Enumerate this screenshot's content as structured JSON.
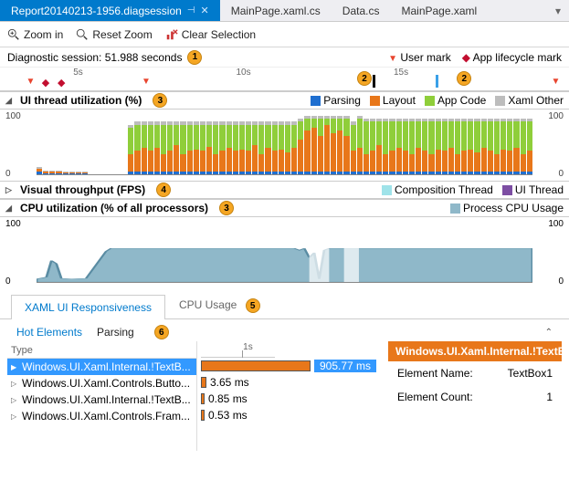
{
  "tabs": {
    "active": "Report20140213-1956.diagsession",
    "others": [
      "MainPage.xaml.cs",
      "Data.cs",
      "MainPage.xaml"
    ]
  },
  "toolbar": {
    "zoom_in": "Zoom in",
    "reset_zoom": "Reset Zoom",
    "clear_sel": "Clear Selection"
  },
  "session": {
    "label": "Diagnostic session: 51.988 seconds",
    "badge": "1"
  },
  "marks": {
    "user": "User mark",
    "lifecycle": "App lifecycle mark"
  },
  "ruler": {
    "ticks": [
      "5s",
      "10s",
      "15s"
    ],
    "badges": [
      "2",
      "2"
    ]
  },
  "ui_thread": {
    "title": "UI thread utilization (%)",
    "badge": "3",
    "legend": {
      "parsing": "Parsing",
      "layout": "Layout",
      "appcode": "App Code",
      "other": "Xaml Other"
    },
    "ymax": "100",
    "ymin": "0"
  },
  "visual": {
    "title": "Visual throughput (FPS)",
    "badge": "4",
    "legend": {
      "comp": "Composition Thread",
      "ui": "UI Thread"
    }
  },
  "cpu": {
    "title": "CPU utilization (% of all processors)",
    "badge": "3",
    "legend": {
      "proc": "Process CPU Usage"
    },
    "ymax": "100",
    "ymin": "0"
  },
  "bottom_tabs": {
    "resp": "XAML UI Responsiveness",
    "cpu": "CPU Usage",
    "badge": "5"
  },
  "sub_tabs": {
    "hot": "Hot Elements",
    "parsing": "Parsing",
    "badge": "6"
  },
  "tree": {
    "header": "Type",
    "rows": [
      "Windows.UI.Xaml.Internal.!TextB...",
      "Windows.UI.Xaml.Controls.Butto...",
      "Windows.UI.Xaml.Internal.!TextB...",
      "Windows.UI.Xaml.Controls.Fram..."
    ]
  },
  "bar_rows": {
    "tick": "1s",
    "r0": "905.77 ms",
    "r1": "3.65 ms",
    "r2": "0.85 ms",
    "r3": "0.53 ms"
  },
  "panel": {
    "title": "Windows.UI.Xaml.Internal.!TextB",
    "name_lbl": "Element Name:",
    "name_val": "TextBox1",
    "count_lbl": "Element Count:",
    "count_val": "1"
  },
  "colors": {
    "parsing": "#1f6fd0",
    "layout": "#e8771a",
    "appcode": "#8fce3a",
    "other": "#bdbdbd",
    "comp": "#9fe3e9",
    "uithread": "#7d4ea3",
    "cpu": "#8fb8c9"
  },
  "chart_data": {
    "type": "bar",
    "stacked": true,
    "categories_seconds": [
      0,
      52
    ],
    "ylim": [
      0,
      100
    ],
    "title": "UI thread utilization (%)",
    "series_names": [
      "Parsing",
      "Layout",
      "App Code",
      "Xaml Other"
    ],
    "bars": [
      [
        5,
        5,
        0,
        2
      ],
      [
        2,
        3,
        0,
        2
      ],
      [
        2,
        3,
        0,
        2
      ],
      [
        2,
        3,
        0,
        2
      ],
      [
        1,
        2,
        0,
        2
      ],
      [
        1,
        2,
        0,
        2
      ],
      [
        1,
        2,
        0,
        1
      ],
      [
        1,
        2,
        0,
        1
      ],
      [
        0,
        0,
        0,
        0
      ],
      [
        0,
        0,
        0,
        0
      ],
      [
        0,
        0,
        0,
        0
      ],
      [
        0,
        0,
        0,
        0
      ],
      [
        0,
        0,
        0,
        0
      ],
      [
        0,
        0,
        0,
        0
      ],
      [
        5,
        30,
        45,
        5
      ],
      [
        5,
        35,
        45,
        5
      ],
      [
        5,
        40,
        40,
        5
      ],
      [
        5,
        35,
        45,
        5
      ],
      [
        5,
        40,
        40,
        5
      ],
      [
        5,
        30,
        50,
        5
      ],
      [
        5,
        35,
        45,
        5
      ],
      [
        5,
        45,
        35,
        5
      ],
      [
        5,
        30,
        50,
        5
      ],
      [
        5,
        35,
        45,
        5
      ],
      [
        5,
        38,
        42,
        5
      ],
      [
        5,
        35,
        45,
        5
      ],
      [
        5,
        42,
        38,
        5
      ],
      [
        5,
        30,
        50,
        5
      ],
      [
        5,
        35,
        45,
        5
      ],
      [
        5,
        40,
        40,
        5
      ],
      [
        5,
        35,
        45,
        5
      ],
      [
        5,
        38,
        42,
        5
      ],
      [
        5,
        35,
        45,
        5
      ],
      [
        5,
        45,
        35,
        5
      ],
      [
        5,
        30,
        50,
        5
      ],
      [
        5,
        40,
        40,
        5
      ],
      [
        5,
        35,
        45,
        5
      ],
      [
        5,
        38,
        42,
        5
      ],
      [
        5,
        32,
        48,
        5
      ],
      [
        5,
        40,
        40,
        5
      ],
      [
        5,
        55,
        30,
        5
      ],
      [
        5,
        70,
        20,
        5
      ],
      [
        5,
        75,
        15,
        5
      ],
      [
        5,
        60,
        30,
        5
      ],
      [
        5,
        80,
        10,
        5
      ],
      [
        5,
        65,
        25,
        5
      ],
      [
        5,
        70,
        20,
        5
      ],
      [
        5,
        60,
        30,
        5
      ],
      [
        5,
        35,
        45,
        5
      ],
      [
        5,
        40,
        50,
        5
      ],
      [
        5,
        30,
        55,
        5
      ],
      [
        5,
        35,
        50,
        5
      ],
      [
        5,
        45,
        40,
        5
      ],
      [
        5,
        30,
        55,
        5
      ],
      [
        5,
        35,
        50,
        5
      ],
      [
        5,
        40,
        45,
        5
      ],
      [
        5,
        35,
        50,
        5
      ],
      [
        5,
        30,
        55,
        5
      ],
      [
        5,
        40,
        45,
        5
      ],
      [
        5,
        35,
        50,
        5
      ],
      [
        5,
        30,
        55,
        5
      ],
      [
        5,
        38,
        47,
        5
      ],
      [
        5,
        35,
        50,
        5
      ],
      [
        5,
        40,
        45,
        5
      ],
      [
        5,
        30,
        55,
        5
      ],
      [
        5,
        35,
        50,
        5
      ],
      [
        5,
        38,
        47,
        5
      ],
      [
        5,
        32,
        53,
        5
      ],
      [
        5,
        40,
        45,
        5
      ],
      [
        5,
        35,
        50,
        5
      ],
      [
        5,
        30,
        55,
        5
      ],
      [
        5,
        38,
        47,
        5
      ],
      [
        5,
        35,
        50,
        5
      ],
      [
        5,
        40,
        45,
        5
      ],
      [
        5,
        30,
        55,
        5
      ],
      [
        5,
        35,
        50,
        5
      ]
    ]
  },
  "cpu_area": {
    "type": "area",
    "ylim": [
      0,
      100
    ],
    "points": [
      [
        0,
        5
      ],
      [
        2,
        8
      ],
      [
        3,
        35
      ],
      [
        4,
        30
      ],
      [
        5,
        6
      ],
      [
        7,
        5
      ],
      [
        10,
        6
      ],
      [
        14,
        50
      ],
      [
        15,
        55
      ],
      [
        52,
        55
      ],
      [
        53,
        52
      ],
      [
        54,
        55
      ],
      [
        55,
        40
      ],
      [
        56,
        48
      ],
      [
        57,
        5
      ],
      [
        58,
        52
      ],
      [
        59,
        55
      ],
      [
        100,
        55
      ]
    ]
  }
}
